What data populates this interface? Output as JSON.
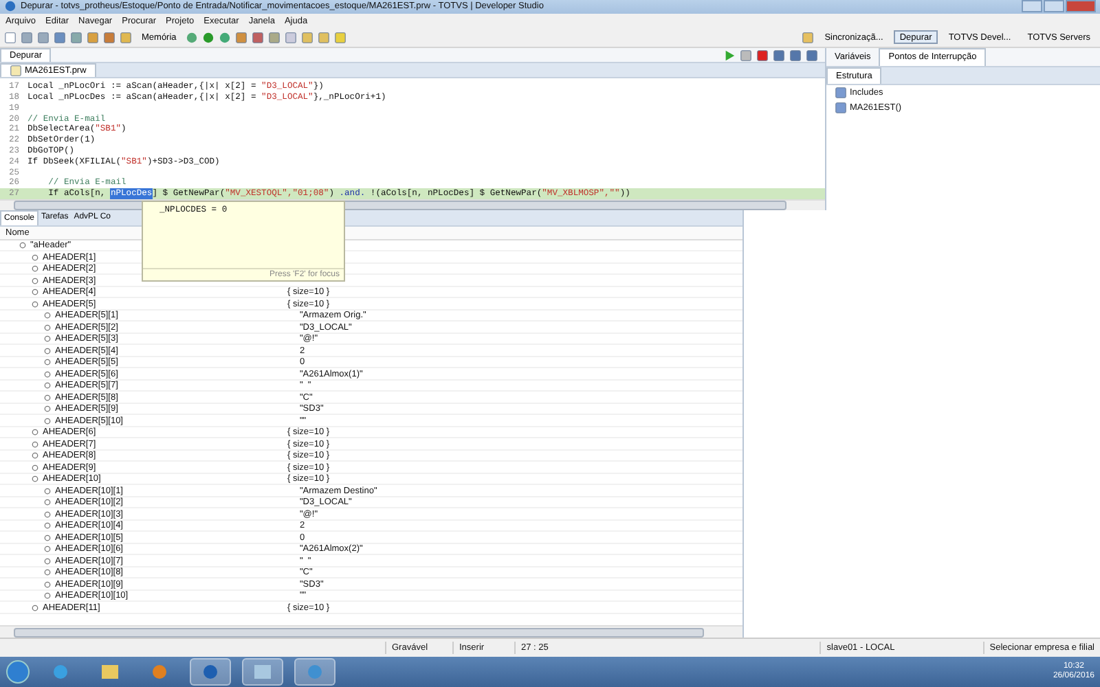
{
  "window": {
    "title": "Depurar - totvs_protheus/Estoque/Ponto de Entrada/Notificar_movimentacoes_estoque/MA261EST.prw - TOTVS | Developer Studio"
  },
  "menu": [
    "Arquivo",
    "Editar",
    "Navegar",
    "Procurar",
    "Projeto",
    "Executar",
    "Janela",
    "Ajuda"
  ],
  "toolbar": {
    "memory_button": "Memória"
  },
  "perspectives": [
    {
      "label": "Sincronizaçã...",
      "selected": false
    },
    {
      "label": "Depurar",
      "selected": true
    },
    {
      "label": "TOTVS Devel...",
      "selected": false
    },
    {
      "label": "TOTVS Servers",
      "selected": false
    }
  ],
  "debug_view": {
    "tab": "Depurar"
  },
  "editor": {
    "tab": "MA261EST.prw",
    "lines": [
      {
        "number": "17",
        "current": false,
        "tokens": [
          {
            "kind": "plain",
            "text": "Local _nPLocOri := aScan(aHeader,{|x| x[2] = "
          },
          {
            "kind": "string",
            "text": "\"D3_LOCAL\""
          },
          {
            "kind": "plain",
            "text": "})"
          }
        ]
      },
      {
        "number": "18",
        "current": false,
        "tokens": [
          {
            "kind": "plain",
            "text": "Local _nPLocDes := aScan(aHeader,{|x| x[2] = "
          },
          {
            "kind": "string",
            "text": "\"D3_LOCAL\""
          },
          {
            "kind": "plain",
            "text": "},_nPLocOri+1)"
          }
        ]
      },
      {
        "number": "19",
        "current": false
      },
      {
        "number": "20",
        "current": false,
        "tokens": [
          {
            "kind": "comment",
            "text": "// Envia E-mail"
          }
        ]
      },
      {
        "number": "21",
        "current": false,
        "tokens": [
          {
            "kind": "plain",
            "text": "DbSelectArea("
          },
          {
            "kind": "string",
            "text": "\"SB1\""
          },
          {
            "kind": "plain",
            "text": ")"
          }
        ]
      },
      {
        "number": "22",
        "current": false,
        "tokens": [
          {
            "kind": "plain",
            "text": "DbSetOrder(1)"
          }
        ]
      },
      {
        "number": "23",
        "current": false,
        "tokens": [
          {
            "kind": "plain",
            "text": "DbGoTOP()"
          }
        ]
      },
      {
        "number": "24",
        "current": false,
        "tokens": [
          {
            "kind": "plain",
            "text": "If DbSeek(XFILIAL("
          },
          {
            "kind": "string",
            "text": "\"SB1\""
          },
          {
            "kind": "plain",
            "text": ")+SD3->D3_COD)"
          }
        ]
      },
      {
        "number": "25",
        "current": false
      },
      {
        "number": "26",
        "current": false,
        "tokens": [
          {
            "kind": "comment",
            "text": "    // Envia E-mail"
          }
        ]
      },
      {
        "number": "27",
        "current": true,
        "tokens": [
          {
            "kind": "plain",
            "text": "    If aCols[n, "
          },
          {
            "kind": "selected",
            "text": "nPLocDes"
          },
          {
            "kind": "plain",
            "text": "] $ GetNewPar("
          },
          {
            "kind": "string",
            "text": "\"MV_XESTOQL\",\"01;08\""
          },
          {
            "kind": "plain",
            "text": ") "
          },
          {
            "kind": "operator",
            "text": ".and."
          },
          {
            "kind": "plain",
            "text": " !(aCols[n, nPLocDes] $ GetNewPar("
          },
          {
            "kind": "string",
            "text": "\"MV_XBLMOSP\",\"\""
          },
          {
            "kind": "plain",
            "text": "))"
          }
        ]
      }
    ]
  },
  "hover": {
    "expression": "_NPLOCDES = 0",
    "hint": "Press 'F2' for focus"
  },
  "right_tabs": [
    {
      "label": "Variáveis",
      "selected": false
    },
    {
      "label": "Pontos de Interrupção",
      "selected": true
    }
  ],
  "outline": {
    "tab": "Estrutura",
    "items": [
      "Includes",
      "MA261EST()"
    ]
  },
  "bottom_tabs": [
    {
      "label": "Console",
      "selected": true
    },
    {
      "label": "Tarefas",
      "selected": false
    },
    {
      "label": "AdvPL Co",
      "selected": false
    }
  ],
  "variables": {
    "column": "Nome",
    "tree": [
      {
        "name": "\"aHeader\"",
        "children": [
          {
            "name": "AHEADER[1]"
          },
          {
            "name": "AHEADER[2]"
          },
          {
            "name": "AHEADER[3]"
          },
          {
            "name": "AHEADER[4]",
            "value": "{ size=10 }"
          },
          {
            "name": "AHEADER[5]",
            "value": "{ size=10 }",
            "children": [
              {
                "name": "AHEADER[5][1]",
                "value": "\"Armazem Orig.\""
              },
              {
                "name": "AHEADER[5][2]",
                "value": "\"D3_LOCAL\""
              },
              {
                "name": "AHEADER[5][3]",
                "value": "\"@!\""
              },
              {
                "name": "AHEADER[5][4]",
                "value": "2"
              },
              {
                "name": "AHEADER[5][5]",
                "value": "0"
              },
              {
                "name": "AHEADER[5][6]",
                "value": "\"A261Almox(1)\""
              },
              {
                "name": "AHEADER[5][7]",
                "value": "\"  \""
              },
              {
                "name": "AHEADER[5][8]",
                "value": "\"C\""
              },
              {
                "name": "AHEADER[5][9]",
                "value": "\"SD3\""
              },
              {
                "name": "AHEADER[5][10]",
                "value": "\"\""
              }
            ]
          },
          {
            "name": "AHEADER[6]",
            "value": "{ size=10 }"
          },
          {
            "name": "AHEADER[7]",
            "value": "{ size=10 }"
          },
          {
            "name": "AHEADER[8]",
            "value": "{ size=10 }"
          },
          {
            "name": "AHEADER[9]",
            "value": "{ size=10 }"
          },
          {
            "name": "AHEADER[10]",
            "value": "{ size=10 }",
            "children": [
              {
                "name": "AHEADER[10][1]",
                "value": "\"Armazem Destino\""
              },
              {
                "name": "AHEADER[10][2]",
                "value": "\"D3_LOCAL\""
              },
              {
                "name": "AHEADER[10][3]",
                "value": "\"@!\""
              },
              {
                "name": "AHEADER[10][4]",
                "value": "2"
              },
              {
                "name": "AHEADER[10][5]",
                "value": "0"
              },
              {
                "name": "AHEADER[10][6]",
                "value": "\"A261Almox(2)\""
              },
              {
                "name": "AHEADER[10][7]",
                "value": "\"  \""
              },
              {
                "name": "AHEADER[10][8]",
                "value": "\"C\""
              },
              {
                "name": "AHEADER[10][9]",
                "value": "\"SD3\""
              },
              {
                "name": "AHEADER[10][10]",
                "value": "\"\""
              }
            ]
          },
          {
            "name": "AHEADER[11]",
            "value": "{ size=10 }"
          }
        ]
      }
    ]
  },
  "status_bar": {
    "mode": "Gravável",
    "insert": "Inserir",
    "position": "27 : 25",
    "server": "slave01 - LOCAL",
    "company": "Selecionar empresa e filial"
  },
  "taskbar": {
    "time": "10:32",
    "date": "26/06/2016"
  }
}
